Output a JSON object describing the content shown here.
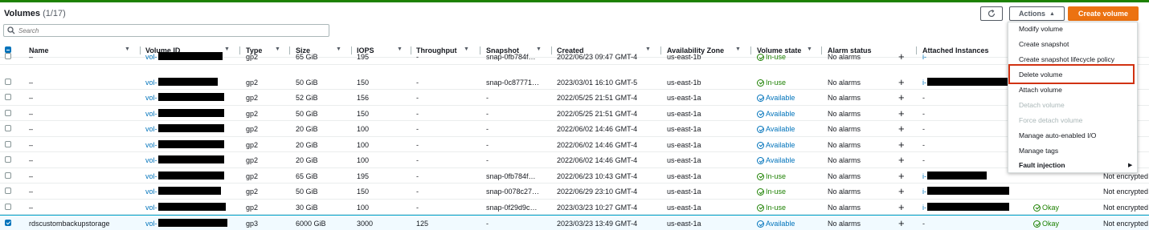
{
  "page": {
    "title": "Volumes",
    "count": "(1/17)",
    "search_placeholder": "Search"
  },
  "toolbar": {
    "actions_label": "Actions",
    "create_label": "Create volume"
  },
  "columns": [
    "Name",
    "Volume ID",
    "Type",
    "Size",
    "IOPS",
    "Throughput",
    "Snapshot",
    "Created",
    "Availability Zone",
    "Volume state",
    "Alarm status",
    "Attached Instances"
  ],
  "rows": [
    {
      "name": "–",
      "vol": "vol-",
      "type": "gp2",
      "size": "65 GiB",
      "iops": "195",
      "thr": "-",
      "snap": "snap-0fb784f…",
      "created": "2022/06/23 09:47 GMT-4",
      "az": "us-east-1b",
      "state": "In-use",
      "alarm": "No alarms",
      "att": "i-",
      "check": "",
      "enc": "",
      "selected": false
    },
    {
      "name": "–",
      "vol": "vol-",
      "type": "gp2",
      "size": "50 GiB",
      "iops": "150",
      "thr": "-",
      "snap": "snap-0c87771…",
      "created": "2023/03/01 16:10 GMT-5",
      "az": "us-east-1b",
      "state": "In-use",
      "alarm": "No alarms",
      "att": "i-",
      "check": "",
      "enc": "",
      "selected": false
    },
    {
      "name": "–",
      "vol": "vol-",
      "type": "gp2",
      "size": "52 GiB",
      "iops": "156",
      "thr": "-",
      "snap": "-",
      "created": "2022/05/25 21:51 GMT-4",
      "az": "us-east-1a",
      "state": "Available",
      "alarm": "No alarms",
      "att": "-",
      "check": "",
      "enc": "",
      "selected": false
    },
    {
      "name": "–",
      "vol": "vol-",
      "type": "gp2",
      "size": "50 GiB",
      "iops": "150",
      "thr": "-",
      "snap": "-",
      "created": "2022/05/25 21:51 GMT-4",
      "az": "us-east-1a",
      "state": "Available",
      "alarm": "No alarms",
      "att": "-",
      "check": "",
      "enc": "",
      "selected": false
    },
    {
      "name": "–",
      "vol": "vol-",
      "type": "gp2",
      "size": "20 GiB",
      "iops": "100",
      "thr": "-",
      "snap": "-",
      "created": "2022/06/02 14:46 GMT-4",
      "az": "us-east-1a",
      "state": "Available",
      "alarm": "No alarms",
      "att": "-",
      "check": "",
      "enc": "",
      "selected": false
    },
    {
      "name": "–",
      "vol": "vol-",
      "type": "gp2",
      "size": "20 GiB",
      "iops": "100",
      "thr": "-",
      "snap": "-",
      "created": "2022/06/02 14:46 GMT-4",
      "az": "us-east-1a",
      "state": "Available",
      "alarm": "No alarms",
      "att": "-",
      "check": "",
      "enc": "",
      "selected": false
    },
    {
      "name": "–",
      "vol": "vol-",
      "type": "gp2",
      "size": "20 GiB",
      "iops": "100",
      "thr": "-",
      "snap": "-",
      "created": "2022/06/02 14:46 GMT-4",
      "az": "us-east-1a",
      "state": "Available",
      "alarm": "No alarms",
      "att": "-",
      "check": "",
      "enc": "",
      "selected": false
    },
    {
      "name": "–",
      "vol": "vol-",
      "type": "gp2",
      "size": "65 GiB",
      "iops": "195",
      "thr": "-",
      "snap": "snap-0fb784f…",
      "created": "2022/06/23 10:43 GMT-4",
      "az": "us-east-1a",
      "state": "In-use",
      "alarm": "No alarms",
      "att": "i-",
      "check": "",
      "enc": "Not encrypted",
      "selected": false
    },
    {
      "name": "–",
      "vol": "vol-",
      "type": "gp2",
      "size": "50 GiB",
      "iops": "150",
      "thr": "-",
      "snap": "snap-0078c27…",
      "created": "2022/06/29 23:10 GMT-4",
      "az": "us-east-1a",
      "state": "In-use",
      "alarm": "No alarms",
      "att": "i-",
      "check": "",
      "enc": "Not encrypted",
      "selected": false
    },
    {
      "name": "–",
      "vol": "vol-",
      "type": "gp2",
      "size": "30 GiB",
      "iops": "100",
      "thr": "-",
      "snap": "snap-0f29d9c…",
      "created": "2023/03/23 10:27 GMT-4",
      "az": "us-east-1a",
      "state": "In-use",
      "alarm": "No alarms",
      "att": "i-",
      "check": "Okay",
      "enc": "Not encrypted",
      "selected": false
    },
    {
      "name": "rdscustombackupstorage",
      "vol": "vol-",
      "type": "gp3",
      "size": "6000 GiB",
      "iops": "3000",
      "thr": "125",
      "snap": "-",
      "created": "2023/03/23 13:49 GMT-4",
      "az": "us-east-1a",
      "state": "Available",
      "alarm": "No alarms",
      "att": "-",
      "check": "Okay",
      "enc": "Not encrypted",
      "selected": true
    }
  ],
  "row8_check": "Okay",
  "menu": [
    {
      "label": "Modify volume",
      "disabled": false,
      "bold": false
    },
    {
      "label": "Create snapshot",
      "disabled": false,
      "bold": false
    },
    {
      "label": "Create snapshot lifecycle policy",
      "disabled": false,
      "bold": false
    },
    {
      "label": "Delete volume",
      "disabled": false,
      "bold": false
    },
    {
      "label": "Attach volume",
      "disabled": false,
      "bold": false
    },
    {
      "label": "Detach volume",
      "disabled": true,
      "bold": false
    },
    {
      "label": "Force detach volume",
      "disabled": true,
      "bold": false
    },
    {
      "label": "Manage auto-enabled I/O",
      "disabled": false,
      "bold": false
    },
    {
      "label": "Manage tags",
      "disabled": false,
      "bold": false
    },
    {
      "label": "Fault injection",
      "disabled": false,
      "bold": true
    }
  ],
  "colors": {
    "accent": "#0073bb",
    "primary": "#ec7211",
    "success": "#1d8102",
    "highlight": "#d13212"
  }
}
